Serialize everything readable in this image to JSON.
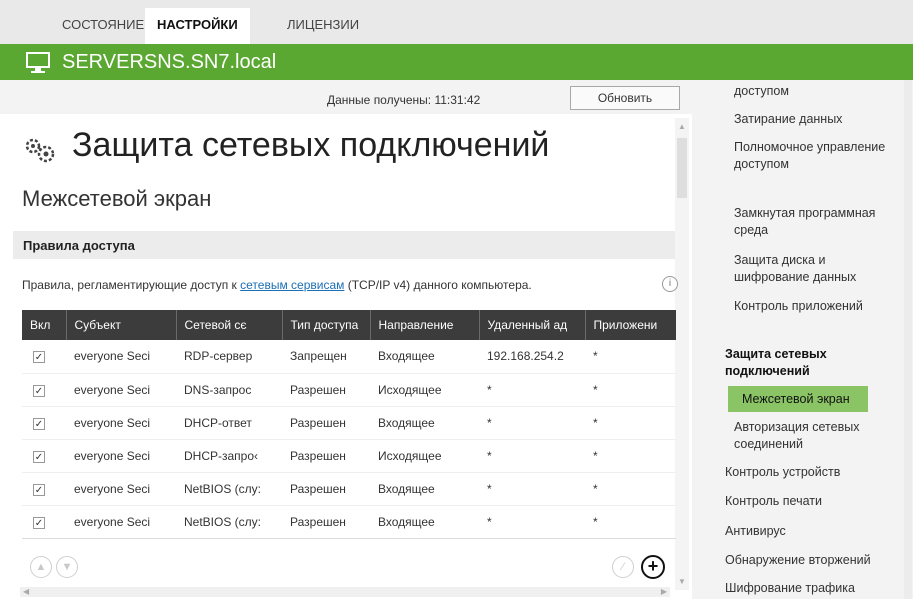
{
  "tabs": [
    "СОСТОЯНИЕ",
    "НАСТРОЙКИ",
    "ЛИЦЕНЗИИ"
  ],
  "server": {
    "name": "SERVERSNS.SN7.local"
  },
  "info": {
    "received_label": "Данные получены:",
    "received_time": "11:31:42",
    "refresh_label": "Обновить"
  },
  "page": {
    "title": "Защита сетевых подключений",
    "section": "Межсетевой экран",
    "subheader": "Правила доступа"
  },
  "description": {
    "before": "Правила, регламентирующие доступ к ",
    "link": "сетевым сервисам",
    "after": " (TCP/IP v4) данного компьютера."
  },
  "table": {
    "headers": [
      "Вкл",
      "Субъект",
      "Сетевой сє",
      "Тип доступа",
      "Направление",
      "Удаленный ад",
      "Приложени"
    ],
    "rows": [
      [
        "✓",
        "everyone Seci",
        "RDP-сервер",
        "Запрещен",
        "Входящее",
        "192.168.254.2",
        "*"
      ],
      [
        "✓",
        "everyone Seci",
        "DNS-запрос",
        "Разрешен",
        "Исходящее",
        "*",
        "*"
      ],
      [
        "✓",
        "everyone Seci",
        "DHCP-ответ",
        "Разрешен",
        "Входящее",
        "*",
        "*"
      ],
      [
        "✓",
        "everyone Seci",
        "DHCP-запро‹",
        "Разрешен",
        "Исходящее",
        "*",
        "*"
      ],
      [
        "✓",
        "everyone Seci",
        "NetBIOS (слу:",
        "Разрешен",
        "Входящее",
        "*",
        "*"
      ],
      [
        "✓",
        "everyone Seci",
        "NetBIOS (слу:",
        "Разрешен",
        "Входящее",
        "*",
        "*"
      ]
    ]
  },
  "nav": {
    "items": [
      "доступом",
      "Затирание данных",
      "Полномочное управление доступом",
      "Замкнутая программная среда",
      "Защита диска и шифрование данных",
      "Контроль приложений",
      "Защита сетевых подключений",
      "Межсетевой экран",
      "Авторизация сетевых соединений",
      "Контроль устройств",
      "Контроль печати",
      "Антивирус",
      "Обнаружение вторжений",
      "Шифрование трафика"
    ]
  },
  "colors": {
    "server_bar": "#5aa832",
    "nav_selected": "#8ac465",
    "table_header": "#3c3c3c",
    "link": "#1a6fb5"
  },
  "icons": [
    "monitor-icon",
    "network-protection-icon",
    "info-icon",
    "move-up-icon",
    "move-down-icon",
    "edit-icon",
    "add-icon"
  ]
}
